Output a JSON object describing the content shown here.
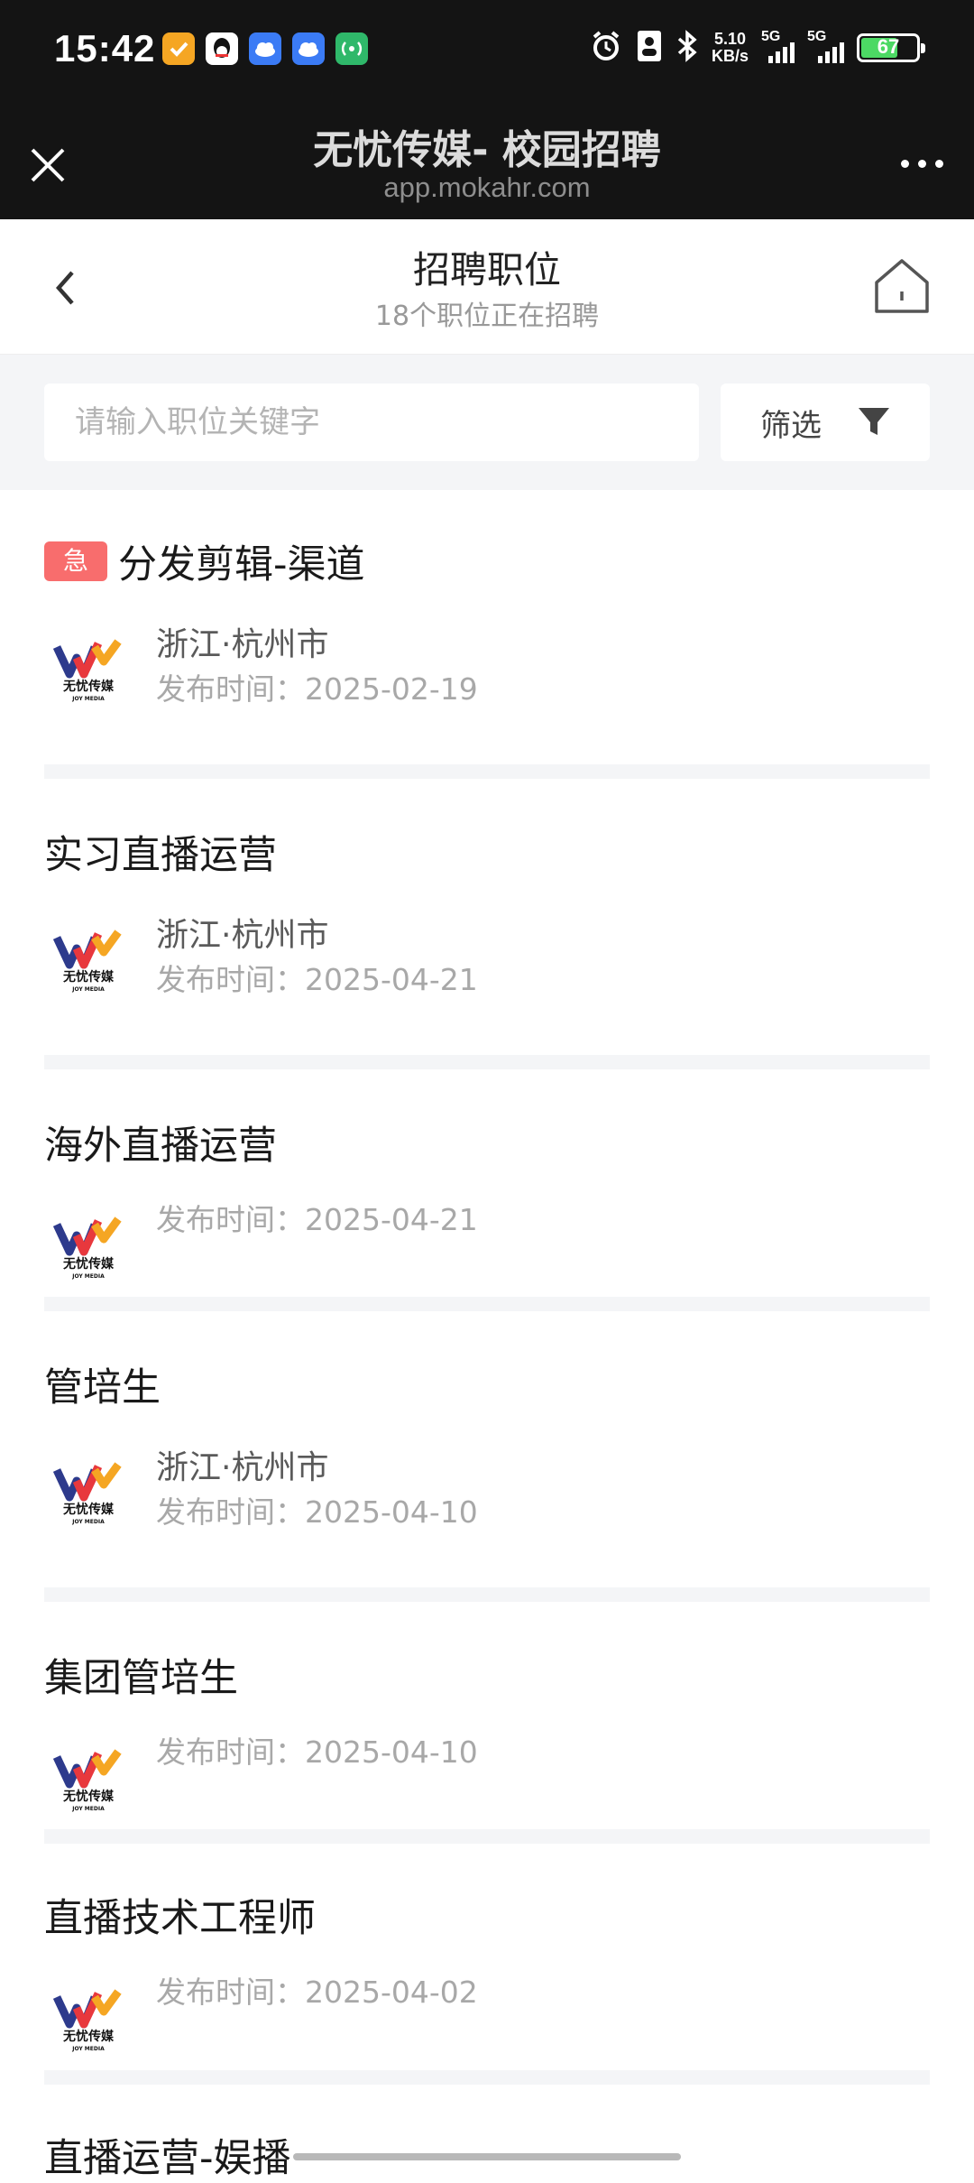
{
  "status_bar": {
    "time": "15:42",
    "net_speed_value": "5.10",
    "net_speed_unit": "KB/s",
    "signal1_label": "5G",
    "signal2_label": "5G",
    "battery": "67",
    "battery_level_percent": 67,
    "app_icons": [
      "notification-app-icon",
      "qq-icon",
      "weather-icon",
      "weather-icon",
      "hotspot-icon"
    ]
  },
  "browser": {
    "title": "无忧传媒- 校园招聘",
    "url": "app.mokahr.com"
  },
  "header": {
    "title": "招聘职位",
    "subtitle": "18个职位正在招聘"
  },
  "search": {
    "placeholder": "请输入职位关键字",
    "filter_label": "筛选"
  },
  "jobs": [
    {
      "title": "分发剪辑-渠道",
      "urgent_label": "急",
      "location": "浙江·杭州市",
      "date": "发布时间：2025-02-19"
    },
    {
      "title": "实习直播运营",
      "location": "浙江·杭州市",
      "date": "发布时间：2025-04-21"
    },
    {
      "title": "海外直播运营",
      "date": "发布时间：2025-04-21"
    },
    {
      "title": "管培生",
      "location": "浙江·杭州市",
      "date": "发布时间：2025-04-10"
    },
    {
      "title": "集团管培生",
      "date": "发布时间：2025-04-10"
    },
    {
      "title": "直播技术工程师",
      "date": "发布时间：2025-04-02"
    },
    {
      "title": "直播运营-娱播"
    }
  ],
  "logo": {
    "brand_text": "无忧传媒",
    "sub_text": "JOY MEDIA"
  },
  "colors": {
    "urgent": "#f86d6d",
    "logo_blue": "#2d3a8c",
    "logo_red": "#e8383d",
    "logo_yellow": "#f5a623",
    "battery_green": "#4cd964"
  }
}
